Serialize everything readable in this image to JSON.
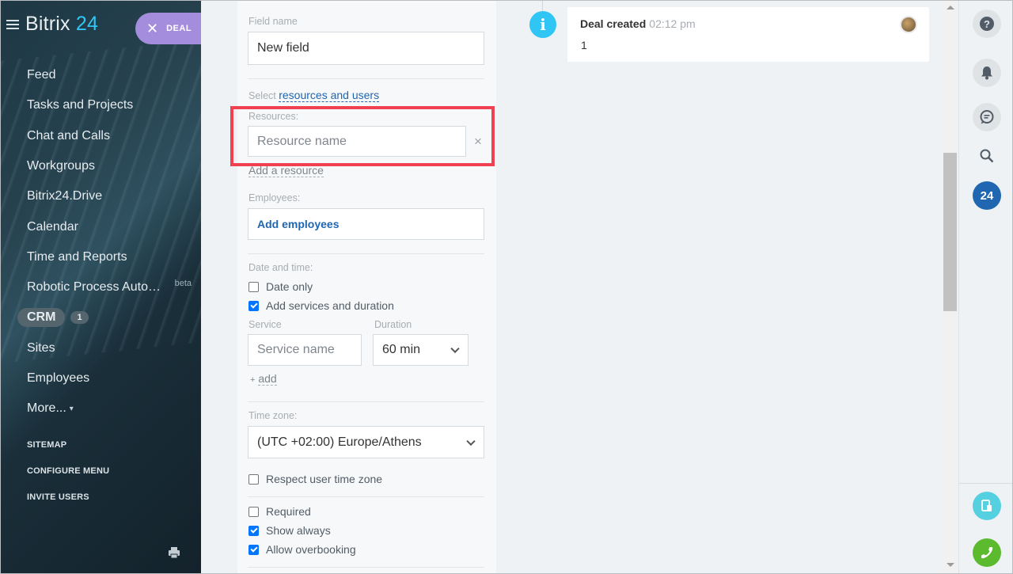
{
  "sidebar": {
    "logo_main": "Bitrix",
    "logo_num": "24",
    "deal_pill": "DEAL",
    "items": [
      {
        "label": "Feed"
      },
      {
        "label": "Tasks and Projects"
      },
      {
        "label": "Chat and Calls"
      },
      {
        "label": "Workgroups"
      },
      {
        "label": "Bitrix24.Drive"
      },
      {
        "label": "Calendar"
      },
      {
        "label": "Time and Reports"
      },
      {
        "label": "Robotic Process Auto…",
        "badge": "beta"
      }
    ],
    "crm": {
      "label": "CRM",
      "count": "1"
    },
    "items2": [
      {
        "label": "Sites"
      },
      {
        "label": "Employees"
      },
      {
        "label": "More..."
      }
    ],
    "system": [
      "SITEMAP",
      "CONFIGURE MENU",
      "INVITE USERS"
    ]
  },
  "form": {
    "field_name_label": "Field name",
    "field_name_value": "New field",
    "select_prefix": "Select",
    "select_link": "resources and users",
    "resources_label": "Resources:",
    "resource_placeholder": "Resource name",
    "remove_glyph": "×",
    "add_resource": "Add a resource",
    "employees_label": "Employees:",
    "add_employees": "Add employees",
    "datetime_label": "Date and time:",
    "date_only": "Date only",
    "add_services": "Add services and duration",
    "service_label": "Service",
    "duration_label": "Duration",
    "service_placeholder": "Service name",
    "duration_value": "60 min",
    "add_plus": "+",
    "add_link": "add",
    "timezone_label": "Time zone:",
    "timezone_value": "(UTC +02:00) Europe/Athens",
    "respect_tz": "Respect user time zone",
    "required": "Required",
    "show_always": "Show always",
    "allow_overbooking": "Allow overbooking",
    "checks": {
      "date_only": false,
      "add_services": true,
      "respect_tz": false,
      "required": false,
      "show_always": true,
      "allow_overbooking": true
    }
  },
  "timeline": {
    "title": "Deal created",
    "time": "02:12 pm",
    "body": "1"
  },
  "rightpanel": {
    "help": "?",
    "b24": "24"
  },
  "colors": {
    "accent": "#2fc6f6",
    "highlight": "#ef4150",
    "deal_pill": "#a58dde",
    "link": "#2066b0",
    "call": "#5cba2f"
  }
}
